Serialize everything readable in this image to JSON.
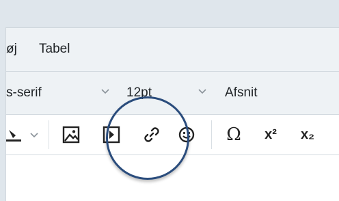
{
  "menu": {
    "items": [
      "øj",
      "Tabel"
    ]
  },
  "format": {
    "font_family": "s-serif",
    "font_size": "12pt",
    "block_format": "Afsnit"
  },
  "toolbar": {
    "buttons": [
      "highlight-color",
      "image",
      "media",
      "link",
      "emoji",
      "special-character",
      "superscript",
      "subscript"
    ],
    "omega": "Ω",
    "superscript_label": "x²",
    "subscript_label": "x₂"
  },
  "colors": {
    "highlight_ring": "#2a4c7c",
    "bar_bg": "#eef2f5",
    "outer_bg": "#dfe6ec"
  }
}
